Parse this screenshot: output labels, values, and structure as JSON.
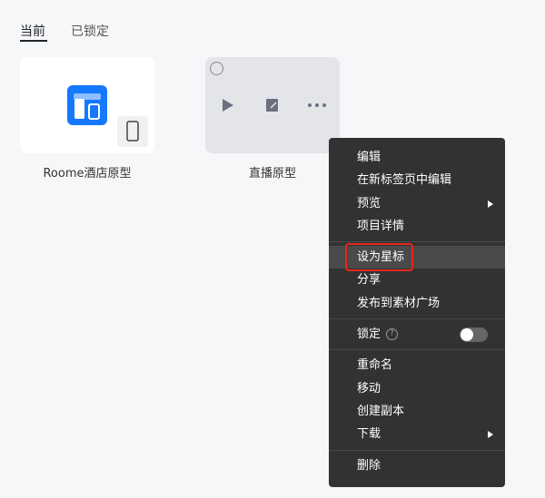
{
  "tabs": [
    {
      "label": "当前",
      "active": true
    },
    {
      "label": "已锁定",
      "active": false
    }
  ],
  "projects": [
    {
      "name": "Roome酒店原型",
      "device": "phone-icon"
    },
    {
      "name": "直播原型"
    }
  ],
  "menu": {
    "group1": [
      "编辑",
      "在新标签页中编辑",
      "预览",
      "项目详情"
    ],
    "group2": [
      "设为星标",
      "分享",
      "发布到素材广场"
    ],
    "lock": {
      "label": "锁定",
      "help": "?",
      "enabled": false
    },
    "group3": [
      "重命名",
      "移动",
      "创建副本",
      "下载"
    ],
    "delete": "删除"
  },
  "colors": {
    "accent": "#1677ff",
    "highlight": "#e8261b"
  }
}
